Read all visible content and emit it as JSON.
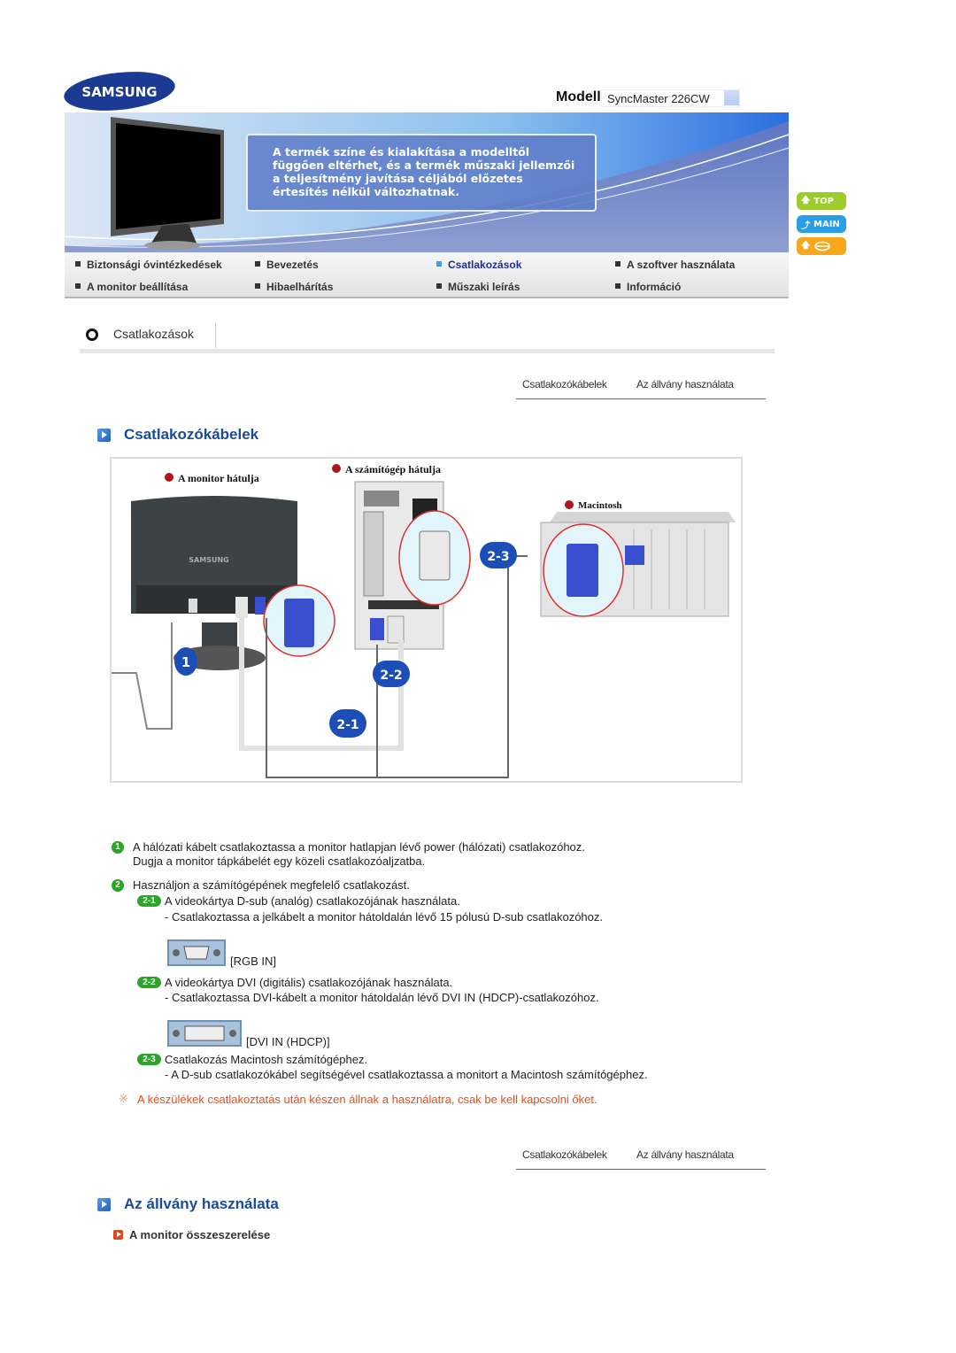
{
  "header": {
    "brand": "SAMSUNG",
    "model_label": "Modell",
    "model_value": "SyncMaster 226CW"
  },
  "banner": {
    "notice": "A termék színe és kialakítása a modelltől függően eltérhet, és a termék műszaki jellemzői a teljesítmény javítása céljából előzetes értesítés nélkül változhatnak."
  },
  "nav": {
    "items": [
      {
        "label": "Biztonsági óvintézkedések",
        "active": false
      },
      {
        "label": "Bevezetés",
        "active": false
      },
      {
        "label": "Csatlakozások",
        "active": true
      },
      {
        "label": "A szoftver használata",
        "active": false
      },
      {
        "label": "A monitor beállítása",
        "active": false
      },
      {
        "label": "Hibaelhárítás",
        "active": false
      },
      {
        "label": "Műszaki leírás",
        "active": false
      },
      {
        "label": "Információ",
        "active": false
      }
    ]
  },
  "side_buttons": {
    "top": {
      "label": "TOP",
      "icon": "arrow-up-icon",
      "color": "#9ccb2c"
    },
    "main": {
      "label": "MAIN",
      "icon": "arrow-turn-icon",
      "color": "#2a9fe6"
    },
    "print": {
      "label": "",
      "icon": "print-icon",
      "color": "#f7a81a"
    }
  },
  "section": {
    "title": "Csatlakozások"
  },
  "subnav": {
    "items": [
      "Csatlakozókábelek",
      "Az állvány használata"
    ]
  },
  "cables": {
    "heading": "Csatlakozókábelek",
    "diagram": {
      "labels": {
        "monitor_back": "A monitor hátulja",
        "pc_back": "A számítógép hátulja",
        "mac": "Macintosh",
        "brand_on_monitor": "SAMSUNG"
      },
      "badges": [
        "1",
        "2-1",
        "2-2",
        "2-3"
      ]
    },
    "step1": {
      "num": "1",
      "line1": "A hálózati kábelt csatlakoztassa a monitor hatlapjan lévő power (hálózati) csatlakozóhoz.",
      "line2": "Dugja a monitor tápkábelét egy közeli csatlakozóaljzatba."
    },
    "step2": {
      "num": "2",
      "text": "Használjon a számítógépének megfelelő csatlakozást.",
      "sub": [
        {
          "badge": "2-1",
          "title": "A videokártya D-sub (analóg) csatlakozójának használata.",
          "detail": "- Csatlakoztassa a jelkábelt a monitor hátoldalán lévő 15 pólusú D-sub csatlakozóhoz.",
          "port_label": "[RGB IN]"
        },
        {
          "badge": "2-2",
          "title": "A videokártya DVI (digitális) csatlakozójának használata.",
          "detail": "- Csatlakoztassa DVI-kábelt a monitor hátoldalán lévő DVI IN (HDCP)-csatlakozóhoz.",
          "port_label": "[DVI IN (HDCP)]"
        },
        {
          "badge": "2-3",
          "title": "Csatlakozás Macintosh számítógéphez.",
          "detail": "- A D-sub csatlakozókábel segítségével csatlakoztassa a monitort a Macintosh számítógéphez."
        }
      ]
    },
    "note_mark": "※",
    "note": "A készülékek csatlakoztatás után készen állnak a használatra, csak be kell kapcsolni őket."
  },
  "stand": {
    "heading": "Az állvány használata",
    "sub_heading": "A monitor összeszerelése"
  }
}
